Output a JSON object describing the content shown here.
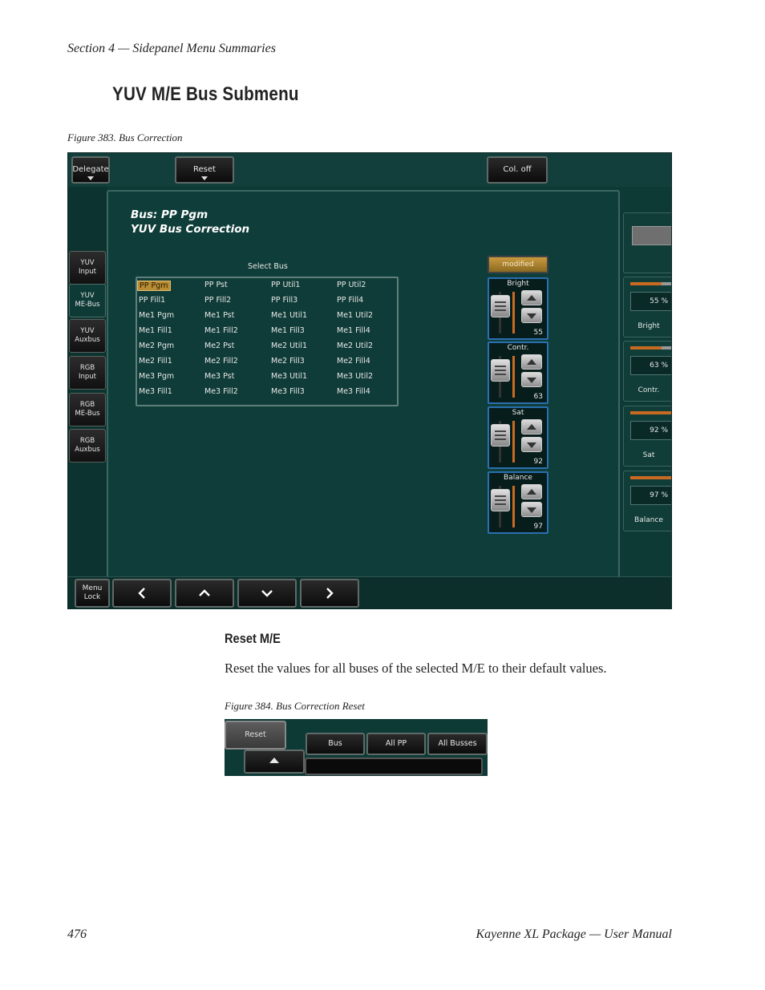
{
  "page": {
    "header": "Section 4 — Sidepanel Menu Summaries",
    "heading": "YUV M/E Bus Submenu",
    "figure1_caption": "Figure 383.  Bus Correction",
    "subheading": "Reset M/E",
    "body": "Reset the values for all buses of the selected M/E to their default values.",
    "figure2_caption": "Figure 384.  Bus Correction Reset",
    "footer_left": "476",
    "footer_right": "Kayenne XL Package  —  User Manual"
  },
  "fig1": {
    "topbar": {
      "delegate": "Delegate",
      "reset": "Reset",
      "col_off": "Col. off"
    },
    "sidetabs": [
      {
        "line1": "YUV",
        "line2": "Input"
      },
      {
        "line1": "YUV",
        "line2": "ME-Bus"
      },
      {
        "line1": "YUV",
        "line2": "Auxbus"
      },
      {
        "line1": "RGB",
        "line2": "Input"
      },
      {
        "line1": "RGB",
        "line2": "ME-Bus"
      },
      {
        "line1": "RGB",
        "line2": "Auxbus"
      }
    ],
    "title_line1": "Bus:  PP  Pgm",
    "title_line2": "YUV Bus Correction",
    "select_bus_label": "Select Bus",
    "buses": [
      [
        "PP  Pgm",
        "PP  Pst",
        "PP  Util1",
        "PP  Util2"
      ],
      [
        "PP  Fill1",
        "PP  Fill2",
        "PP  Fill3",
        "PP  Fill4"
      ],
      [
        "Me1  Pgm",
        "Me1  Pst",
        "Me1  Util1",
        "Me1  Util2"
      ],
      [
        "Me1  Fill1",
        "Me1  Fill2",
        "Me1  Fill3",
        "Me1  Fill4"
      ],
      [
        "Me2  Pgm",
        "Me2  Pst",
        "Me2  Util1",
        "Me2  Util2"
      ],
      [
        "Me2  Fill1",
        "Me2  Fill2",
        "Me2  Fill3",
        "Me2  Fill4"
      ],
      [
        "Me3  Pgm",
        "Me3  Pst",
        "Me3  Util1",
        "Me3  Util2"
      ],
      [
        "Me3  Fill1",
        "Me3  Fill2",
        "Me3  Fill3",
        "Me3  Fill4"
      ]
    ],
    "selected_bus": "PP  Pgm",
    "modified_label": "modified",
    "controls": [
      {
        "label": "Bright",
        "value": "55"
      },
      {
        "label": "Contr.",
        "value": "63"
      },
      {
        "label": "Sat",
        "value": "92"
      },
      {
        "label": "Balance",
        "value": "97"
      }
    ],
    "right_values": [
      {
        "value": "55  %",
        "label": "Bright"
      },
      {
        "value": "63  %",
        "label": "Contr."
      },
      {
        "value": "92  %",
        "label": "Sat"
      },
      {
        "value": "97  %",
        "label": "Balance"
      }
    ],
    "bottombar": {
      "menu_lock_line1": "Menu",
      "menu_lock_line2": "Lock"
    },
    "colors": {
      "panel_bg": "#0e3a36",
      "selected": "#b98d36",
      "accent_orange": "#c96a22",
      "control_border": "#2a6fb0"
    }
  },
  "fig2": {
    "reset": "Reset",
    "bus": "Bus",
    "all_pp": "All PP",
    "all_buses": "All Busses"
  }
}
